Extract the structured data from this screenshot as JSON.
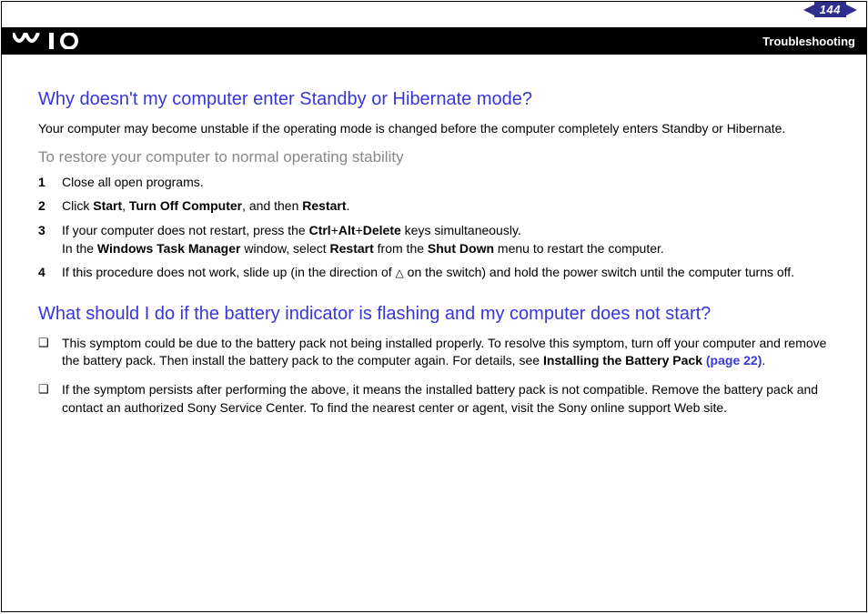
{
  "header": {
    "page_number": "144",
    "section": "Troubleshooting"
  },
  "q1": {
    "heading": "Why doesn't my computer enter Standby or Hibernate mode?",
    "intro": "Your computer may become unstable if the operating mode is changed before the computer completely enters Standby or Hibernate.",
    "subheading": "To restore your computer to normal operating stability",
    "steps": [
      {
        "n": "1",
        "text": "Close all open programs."
      },
      {
        "n": "2",
        "prefix": "Click ",
        "b1": "Start",
        "sep1": ", ",
        "b2": "Turn Off Computer",
        "sep2": ", and then ",
        "b3": "Restart",
        "suffix": "."
      },
      {
        "n": "3",
        "line1_prefix": "If your computer does not restart, press the ",
        "b1": "Ctrl",
        "plus1": "+",
        "b2": "Alt",
        "plus2": "+",
        "b3": "Delete",
        "line1_suffix": " keys simultaneously.",
        "line2_prefix": "In the ",
        "b4": "Windows Task Manager",
        "mid1": " window, select ",
        "b5": "Restart",
        "mid2": " from the ",
        "b6": "Shut Down",
        "line2_suffix": " menu to restart the computer."
      },
      {
        "n": "4",
        "text_before": "If this procedure does not work, slide up (in the direction of ",
        "text_after": " on the switch) and hold the power switch until the computer turns off."
      }
    ]
  },
  "q2": {
    "heading": "What should I do if the battery indicator is flashing and my computer does not start?",
    "bullets": [
      {
        "prefix": "This symptom could be due to the battery pack not being installed properly. To resolve this symptom, turn off your computer and remove the battery pack. Then install the battery pack to the computer again. For details, see ",
        "b1": "Installing the Battery Pack ",
        "link": "(page 22)",
        "suffix": "."
      },
      {
        "text": "If the symptom persists after performing the above, it means the installed battery pack is not compatible. Remove the battery pack and contact an authorized Sony Service Center. To find the nearest center or agent, visit the Sony online support Web site."
      }
    ]
  }
}
